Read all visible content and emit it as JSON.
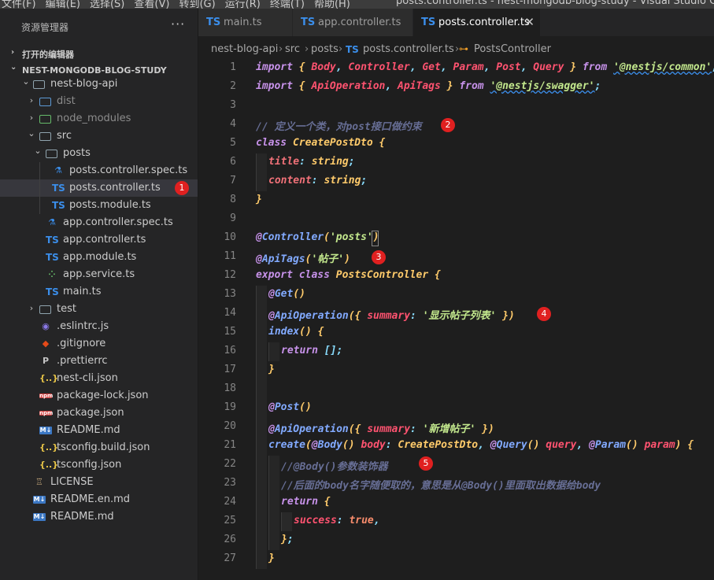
{
  "window": {
    "menu": [
      "文件(F)",
      "编辑(E)",
      "选择(S)",
      "查看(V)",
      "转到(G)",
      "运行(R)",
      "终端(T)",
      "帮助(H)"
    ],
    "title": "posts.controller.ts - nest-mongodb-blog-study - Visual Studio Code"
  },
  "sidebar": {
    "title": "资源管理器",
    "more": "···",
    "open_editors": "打开的编辑器",
    "project": "NEST-MONGODB-BLOG-STUDY",
    "items": [
      {
        "label": "nest-blog-api"
      },
      {
        "label": "dist"
      },
      {
        "label": "node_modules"
      },
      {
        "label": "src"
      },
      {
        "label": "posts"
      },
      {
        "label": "posts.controller.spec.ts"
      },
      {
        "label": "posts.controller.ts"
      },
      {
        "label": "posts.module.ts"
      },
      {
        "label": "app.controller.spec.ts"
      },
      {
        "label": "app.controller.ts"
      },
      {
        "label": "app.module.ts"
      },
      {
        "label": "app.service.ts"
      },
      {
        "label": "main.ts"
      },
      {
        "label": "test"
      },
      {
        "label": ".eslintrc.js"
      },
      {
        "label": ".gitignore"
      },
      {
        "label": ".prettierrc"
      },
      {
        "label": "nest-cli.json"
      },
      {
        "label": "package-lock.json"
      },
      {
        "label": "package.json"
      },
      {
        "label": "README.md"
      },
      {
        "label": "tsconfig.build.json"
      },
      {
        "label": "tsconfig.json"
      },
      {
        "label": "LICENSE"
      },
      {
        "label": "README.en.md"
      },
      {
        "label": "README.md"
      }
    ]
  },
  "icons": {
    "ts": "TS",
    "json": "{..}",
    "npm": "npm",
    "md": "M↓",
    "chevron_right": "›",
    "chevron_down": "⌄",
    "close": "✕",
    "symbol": "⊶"
  },
  "tabs": [
    {
      "label": "main.ts"
    },
    {
      "label": "app.controller.ts"
    },
    {
      "label": "posts.controller.ts"
    }
  ],
  "breadcrumb": [
    "nest-blog-api",
    "src",
    "posts",
    "posts.controller.ts",
    "PostsController"
  ],
  "badges": [
    "1",
    "2",
    "3",
    "4",
    "5"
  ],
  "code": {
    "line_numbers": [
      "1",
      "2",
      "3",
      "4",
      "5",
      "6",
      "7",
      "8",
      "9",
      "10",
      "11",
      "12",
      "13",
      "14",
      "15",
      "16",
      "17",
      "18",
      "19",
      "20",
      "21",
      "22",
      "23",
      "24",
      "25",
      "26",
      "27"
    ],
    "l1": {
      "import": "import",
      "ob": "{",
      "body": "Body",
      "c1": ",",
      "controller": "Controller",
      "c2": ",",
      "get": "Get",
      "c3": ",",
      "param": "Param",
      "c4": ",",
      "post": "Post",
      "c5": ",",
      "query": "Query",
      "cb": "}",
      "from": "from",
      "mod": "'@nestjs/common'",
      "semi": ";"
    },
    "l2": {
      "import": "import",
      "ob": "{",
      "apiop": "ApiOperation",
      "c1": ",",
      "apitags": "ApiTags",
      "cb": "}",
      "from": "from",
      "mod": "'@nestjs/swagger'",
      "semi": ";"
    },
    "l4": "// 定义一个类，对post接口做约束",
    "l5": {
      "class": "class",
      "name": "CreatePostDto",
      "ob": "{"
    },
    "l6": {
      "prop": "title",
      "colon": ":",
      "type": "string",
      "semi": ";"
    },
    "l7": {
      "prop": "content",
      "colon": ":",
      "type": "string",
      "semi": ";"
    },
    "l8": "}",
    "l10": {
      "at": "@",
      "dec": "Controller",
      "op": "(",
      "str": "'posts'",
      "cp": ")"
    },
    "l11": {
      "at": "@",
      "dec": "ApiTags",
      "op": "(",
      "str": "'帖子'",
      "cp": ")"
    },
    "l12": {
      "export": "export",
      "class": "class",
      "name": "PostsController",
      "ob": "{"
    },
    "l13": {
      "at": "@",
      "dec": "Get",
      "parens": "()"
    },
    "l14": {
      "at": "@",
      "dec": "ApiOperation",
      "op": "({",
      "key": "summary",
      "colon": ":",
      "str": "'显示帖子列表'",
      "cl": "})"
    },
    "l15": {
      "fn": "index",
      "parens": "()",
      "ob": "{"
    },
    "l16": {
      "ret": "return",
      "val": "[]",
      "semi": ";"
    },
    "l17": "}",
    "l19": {
      "at": "@",
      "dec": "Post",
      "parens": "()"
    },
    "l20": {
      "at": "@",
      "dec": "ApiOperation",
      "op": "({",
      "key": "summary",
      "colon": ":",
      "str": "'新增帖子'",
      "cl": "})"
    },
    "l21": {
      "fn": "create",
      "op": "(",
      "at1": "@",
      "body": "Body",
      "p1": "()",
      "arg1": "body",
      "col1": ":",
      "type1": "CreatePostDto",
      "comma1": ",",
      "at2": "@",
      "query": "Query",
      "p2": "()",
      "arg2": "query",
      "comma2": ",",
      "at3": "@",
      "param": "Param",
      "p3": "()",
      "arg3": "param",
      "cp": ")",
      "ob": "{"
    },
    "l22": "//@Body()参数装饰器",
    "l23": "//后面的body名字随便取的，意思是从@Body()里面取出数据给body",
    "l24": {
      "ret": "return",
      "ob": "{"
    },
    "l25": {
      "key": "success",
      "colon": ":",
      "val": "true",
      "comma": ","
    },
    "l26": {
      "cb": "}",
      "semi": ";"
    },
    "l27": "}"
  },
  "colors": {
    "keyword": "#c792ea",
    "identifier": "#ff5370",
    "string": "#c3e88d",
    "function": "#82aaff",
    "type": "#ffcb6b",
    "comment": "#676e95",
    "badge": "#e02020",
    "ts_blue": "#3b8eea"
  }
}
